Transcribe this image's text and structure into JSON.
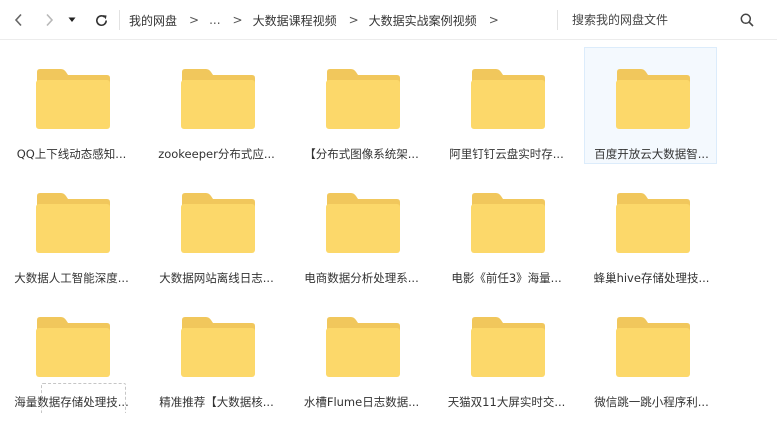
{
  "toolbar": {
    "back_icon": "chevron-left-icon",
    "forward_icon": "chevron-right-icon",
    "dropdown_icon": "caret-down-icon",
    "refresh_icon": "refresh-icon",
    "search_icon": "magnifier-icon"
  },
  "breadcrumb": {
    "root": "我的网盘",
    "sep": ">",
    "ellipsis": "...",
    "level1": "大数据课程视频",
    "level2": "大数据实战案例视频"
  },
  "search": {
    "placeholder": "搜索我的网盘文件"
  },
  "colors": {
    "folder_back": "#f1c75c",
    "folder_front": "#fcd86a",
    "selected_bg": "#f4f9fe",
    "selected_border": "#dcecfb"
  },
  "folders": [
    {
      "label": "QQ上下线动态感知..."
    },
    {
      "label": "zookeeper分布式应..."
    },
    {
      "label": "【分布式图像系统架..."
    },
    {
      "label": "阿里钉钉云盘实时存..."
    },
    {
      "label": "百度开放云大数据智...",
      "selected": true
    },
    {
      "label": "大数据人工智能深度..."
    },
    {
      "label": "大数据网站离线日志..."
    },
    {
      "label": "电商数据分析处理系..."
    },
    {
      "label": "电影《前任3》海量..."
    },
    {
      "label": "蜂巢hive存储处理技..."
    },
    {
      "label": "海量数据存储处理技..."
    },
    {
      "label": "精准推荐【大数据核..."
    },
    {
      "label": "水槽Flume日志数据..."
    },
    {
      "label": "天猫双11大屏实时交..."
    },
    {
      "label": "微信跳一跳小程序利..."
    }
  ]
}
